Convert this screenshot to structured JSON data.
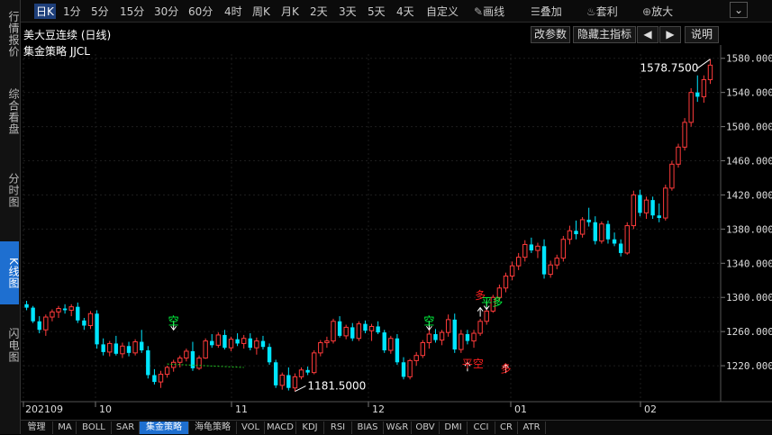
{
  "leftnav": [
    {
      "label": "行情报价",
      "active": false
    },
    {
      "label": "综合看盘",
      "active": false
    },
    {
      "label": "分时图",
      "active": false
    },
    {
      "label": "K线图",
      "active": true
    },
    {
      "label": "闪电图",
      "active": false
    }
  ],
  "toolbar": {
    "periods": [
      "日K",
      "1分",
      "5分",
      "15分",
      "30分",
      "60分",
      "4时",
      "周K",
      "月K",
      "2天",
      "3天",
      "5天",
      "4天",
      "自定义"
    ],
    "draw_label": "画线",
    "overlay_label": "叠加",
    "arbitrage_label": "套利",
    "zoom_label": "放大"
  },
  "header": {
    "title": "美大豆连续 (日线)",
    "strategy": "集金策略 JJCL",
    "buttons": {
      "params": "改参数",
      "hide": "隐藏主指标",
      "prev": "◀",
      "next": "▶",
      "help": "说明"
    }
  },
  "chart_data": {
    "type": "candlestick",
    "ylim": [
      1185,
      1580
    ],
    "yticks": [
      "1580.0000",
      "1540.0000",
      "1500.0000",
      "1460.0000",
      "1420.0000",
      "1380.0000",
      "1340.0000",
      "1300.0000",
      "1260.0000",
      "1220.0000"
    ],
    "xticks": [
      "202109",
      "10",
      "11",
      "12",
      "01",
      "02"
    ],
    "max_label": "1578.7500",
    "min_label": "1181.5000",
    "signals": [
      {
        "text": "空",
        "color": "#00ff40"
      },
      {
        "text": "空",
        "color": "#00ff40"
      },
      {
        "text": "多",
        "color": "#ff2020"
      },
      {
        "text": "平多",
        "color": "#00ff40"
      },
      {
        "text": "平空",
        "color": "#ff2020"
      },
      {
        "text": "多",
        "color": "#ff2020"
      }
    ],
    "ohlc": [
      [
        1292,
        1296,
        1285,
        1288
      ],
      [
        1288,
        1290,
        1270,
        1272
      ],
      [
        1272,
        1278,
        1258,
        1262
      ],
      [
        1262,
        1280,
        1255,
        1277
      ],
      [
        1277,
        1286,
        1272,
        1283
      ],
      [
        1283,
        1290,
        1276,
        1287
      ],
      [
        1287,
        1292,
        1281,
        1285
      ],
      [
        1285,
        1292,
        1278,
        1289
      ],
      [
        1289,
        1294,
        1270,
        1273
      ],
      [
        1273,
        1276,
        1262,
        1267
      ],
      [
        1267,
        1284,
        1263,
        1281
      ],
      [
        1281,
        1285,
        1240,
        1245
      ],
      [
        1245,
        1252,
        1232,
        1236
      ],
      [
        1236,
        1249,
        1231,
        1246
      ],
      [
        1246,
        1255,
        1232,
        1234
      ],
      [
        1234,
        1247,
        1229,
        1243
      ],
      [
        1243,
        1248,
        1231,
        1235
      ],
      [
        1235,
        1251,
        1232,
        1248
      ],
      [
        1248,
        1262,
        1235,
        1238
      ],
      [
        1238,
        1243,
        1205,
        1209
      ],
      [
        1209,
        1216,
        1198,
        1201
      ],
      [
        1201,
        1214,
        1194,
        1210
      ],
      [
        1210,
        1220,
        1206,
        1218
      ],
      [
        1218,
        1227,
        1213,
        1224
      ],
      [
        1224,
        1232,
        1218,
        1229
      ],
      [
        1229,
        1240,
        1225,
        1237
      ],
      [
        1237,
        1248,
        1214,
        1217
      ],
      [
        1217,
        1232,
        1215,
        1229
      ],
      [
        1229,
        1252,
        1228,
        1249
      ],
      [
        1249,
        1257,
        1241,
        1244
      ],
      [
        1244,
        1259,
        1241,
        1256
      ],
      [
        1256,
        1262,
        1239,
        1241
      ],
      [
        1241,
        1254,
        1237,
        1251
      ],
      [
        1251,
        1258,
        1243,
        1246
      ],
      [
        1246,
        1256,
        1240,
        1252
      ],
      [
        1252,
        1258,
        1238,
        1241
      ],
      [
        1241,
        1253,
        1233,
        1249
      ],
      [
        1249,
        1255,
        1239,
        1242
      ],
      [
        1242,
        1246,
        1221,
        1224
      ],
      [
        1224,
        1227,
        1194,
        1197
      ],
      [
        1197,
        1212,
        1192,
        1209
      ],
      [
        1209,
        1218,
        1191,
        1194
      ],
      [
        1194,
        1211,
        1190,
        1207
      ],
      [
        1207,
        1218,
        1204,
        1215
      ],
      [
        1215,
        1219,
        1209,
        1212
      ],
      [
        1212,
        1238,
        1210,
        1235
      ],
      [
        1235,
        1250,
        1231,
        1247
      ],
      [
        1247,
        1254,
        1241,
        1249
      ],
      [
        1249,
        1275,
        1246,
        1272
      ],
      [
        1272,
        1278,
        1253,
        1255
      ],
      [
        1255,
        1268,
        1251,
        1265
      ],
      [
        1265,
        1270,
        1249,
        1252
      ],
      [
        1252,
        1272,
        1249,
        1269
      ],
      [
        1269,
        1273,
        1258,
        1261
      ],
      [
        1261,
        1269,
        1249,
        1266
      ],
      [
        1266,
        1272,
        1257,
        1259
      ],
      [
        1259,
        1262,
        1235,
        1238
      ],
      [
        1238,
        1255,
        1234,
        1252
      ],
      [
        1252,
        1257,
        1221,
        1224
      ],
      [
        1224,
        1230,
        1204,
        1207
      ],
      [
        1207,
        1228,
        1204,
        1226
      ],
      [
        1226,
        1236,
        1220,
        1232
      ],
      [
        1232,
        1250,
        1229,
        1247
      ],
      [
        1247,
        1262,
        1240,
        1257
      ],
      [
        1257,
        1263,
        1247,
        1250
      ],
      [
        1250,
        1262,
        1244,
        1259
      ],
      [
        1259,
        1280,
        1254,
        1274
      ],
      [
        1274,
        1281,
        1235,
        1239
      ],
      [
        1239,
        1262,
        1235,
        1257
      ],
      [
        1257,
        1262,
        1245,
        1249
      ],
      [
        1249,
        1262,
        1241,
        1258
      ],
      [
        1258,
        1275,
        1255,
        1272
      ],
      [
        1272,
        1286,
        1268,
        1284
      ],
      [
        1284,
        1303,
        1282,
        1300
      ],
      [
        1300,
        1315,
        1296,
        1311
      ],
      [
        1311,
        1329,
        1306,
        1325
      ],
      [
        1325,
        1342,
        1320,
        1337
      ],
      [
        1337,
        1352,
        1332,
        1347
      ],
      [
        1347,
        1367,
        1342,
        1362
      ],
      [
        1362,
        1370,
        1352,
        1355
      ],
      [
        1355,
        1364,
        1346,
        1360
      ],
      [
        1360,
        1368,
        1322,
        1327
      ],
      [
        1327,
        1343,
        1323,
        1338
      ],
      [
        1338,
        1350,
        1333,
        1346
      ],
      [
        1346,
        1372,
        1342,
        1368
      ],
      [
        1368,
        1384,
        1362,
        1378
      ],
      [
        1378,
        1390,
        1368,
        1374
      ],
      [
        1374,
        1394,
        1370,
        1391
      ],
      [
        1391,
        1405,
        1383,
        1388
      ],
      [
        1388,
        1395,
        1362,
        1366
      ],
      [
        1366,
        1389,
        1363,
        1386
      ],
      [
        1386,
        1390,
        1363,
        1368
      ],
      [
        1368,
        1376,
        1360,
        1363
      ],
      [
        1363,
        1368,
        1348,
        1352
      ],
      [
        1352,
        1388,
        1350,
        1384
      ],
      [
        1384,
        1425,
        1380,
        1420
      ],
      [
        1420,
        1426,
        1395,
        1399
      ],
      [
        1399,
        1418,
        1392,
        1414
      ],
      [
        1414,
        1418,
        1392,
        1396
      ],
      [
        1396,
        1410,
        1388,
        1393
      ],
      [
        1393,
        1432,
        1390,
        1428
      ],
      [
        1428,
        1460,
        1425,
        1456
      ],
      [
        1456,
        1480,
        1452,
        1476
      ],
      [
        1476,
        1510,
        1472,
        1505
      ],
      [
        1505,
        1545,
        1500,
        1540
      ],
      [
        1540,
        1560,
        1529,
        1535
      ],
      [
        1535,
        1560,
        1528,
        1555
      ],
      [
        1555,
        1579,
        1550,
        1572
      ]
    ]
  }
}
